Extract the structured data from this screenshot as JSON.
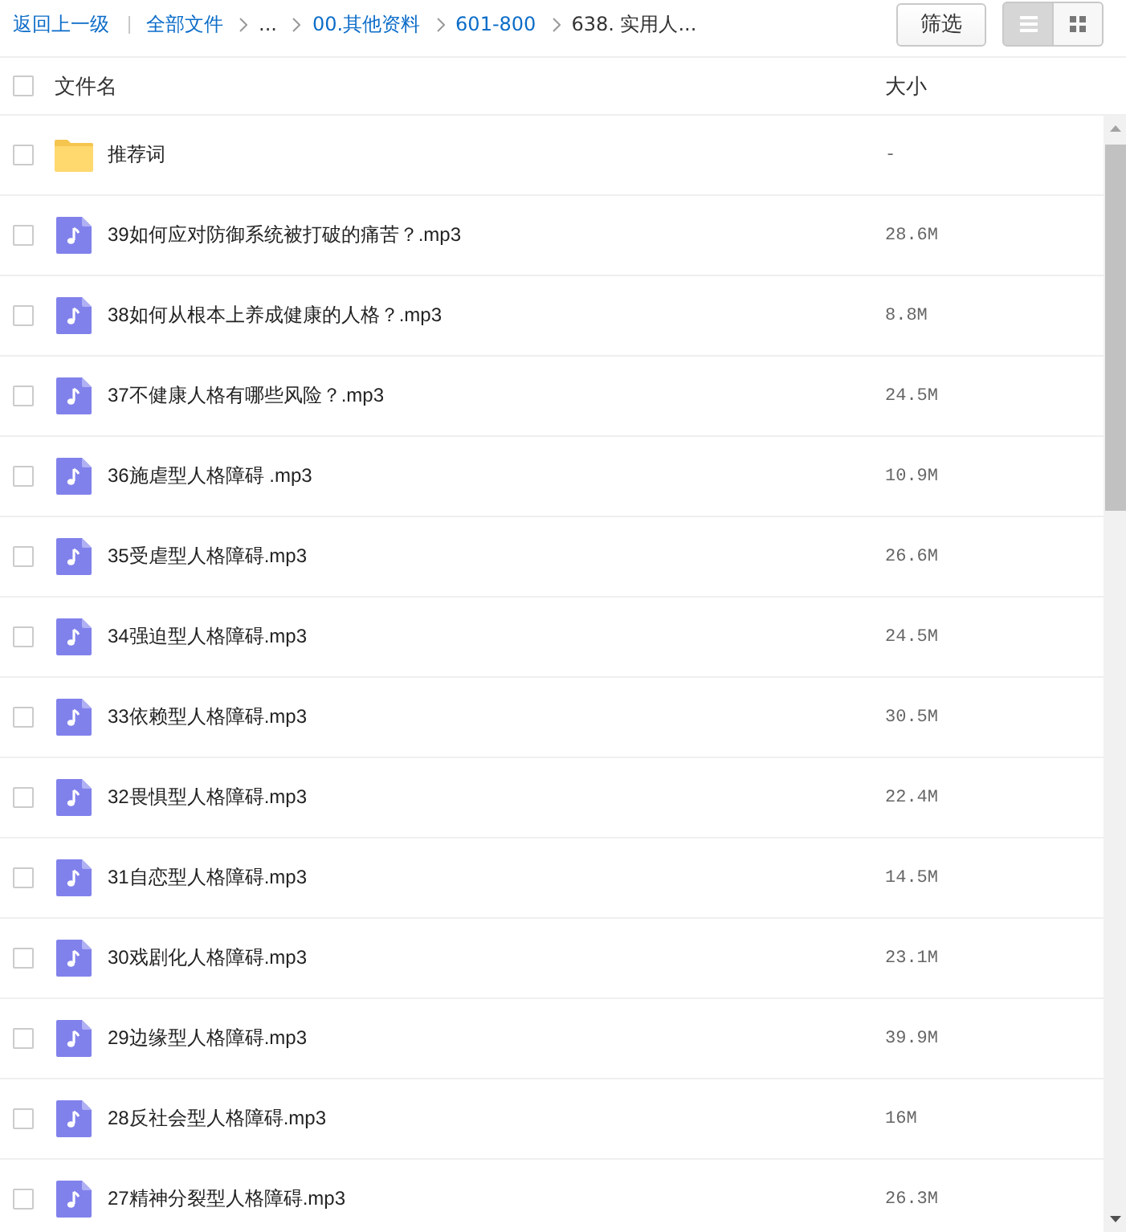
{
  "breadcrumb": {
    "back": "返回上一级",
    "root": "全部文件",
    "items": [
      {
        "kind": "ellipsis",
        "label": "..."
      },
      {
        "kind": "link",
        "label": "00.其他资料"
      },
      {
        "kind": "link",
        "label": "601-800"
      },
      {
        "kind": "current",
        "label": "638. 实用人..."
      }
    ]
  },
  "filter_button": "筛选",
  "view_toggle": [
    {
      "kind": "list",
      "selected": true
    },
    {
      "kind": "grid",
      "selected": false
    }
  ],
  "select_all": {
    "checked": false
  },
  "columns": [
    "文件名",
    "大小"
  ],
  "rows": [
    {
      "kind": "folder",
      "name": "推荐词",
      "size": "-",
      "checked": false
    },
    {
      "kind": "audio",
      "name": "39如何应对防御系统被打破的痛苦？.mp3",
      "size": "28.6M",
      "checked": false
    },
    {
      "kind": "audio",
      "name": "38如何从根本上养成健康的人格？.mp3",
      "size": "8.8M",
      "checked": false
    },
    {
      "kind": "audio",
      "name": "37不健康人格有哪些风险？.mp3",
      "size": "24.5M",
      "checked": false
    },
    {
      "kind": "audio",
      "name": "36施虐型人格障碍 .mp3",
      "size": "10.9M",
      "checked": false
    },
    {
      "kind": "audio",
      "name": "35受虐型人格障碍.mp3",
      "size": "26.6M",
      "checked": false
    },
    {
      "kind": "audio",
      "name": "34强迫型人格障碍.mp3",
      "size": "24.5M",
      "checked": false
    },
    {
      "kind": "audio",
      "name": "33依赖型人格障碍.mp3",
      "size": "30.5M",
      "checked": false
    },
    {
      "kind": "audio",
      "name": "32畏惧型人格障碍.mp3",
      "size": "22.4M",
      "checked": false
    },
    {
      "kind": "audio",
      "name": "31自恋型人格障碍.mp3",
      "size": "14.5M",
      "checked": false
    },
    {
      "kind": "audio",
      "name": "30戏剧化人格障碍.mp3",
      "size": "23.1M",
      "checked": false
    },
    {
      "kind": "audio",
      "name": "29边缘型人格障碍.mp3",
      "size": "39.9M",
      "checked": false
    },
    {
      "kind": "audio",
      "name": "28反社会型人格障碍.mp3",
      "size": "16M",
      "checked": false
    },
    {
      "kind": "audio",
      "name": "27精神分裂型人格障碍.mp3",
      "size": "26.3M",
      "checked": false
    }
  ]
}
